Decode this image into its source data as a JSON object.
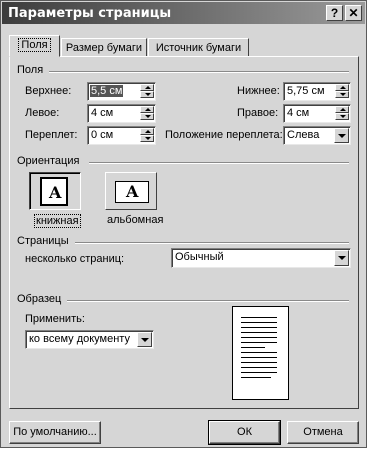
{
  "window": {
    "title": "Параметры страницы",
    "help_glyph": "?",
    "close_glyph": "✕"
  },
  "tabs": [
    {
      "label": "Поля",
      "active": true
    },
    {
      "label": "Размер бумаги",
      "active": false
    },
    {
      "label": "Источник бумаги",
      "active": false
    }
  ],
  "margins": {
    "section_title": "Поля",
    "top": {
      "label": "Верхнее:",
      "value": "5,5 см"
    },
    "bottom": {
      "label": "Нижнее:",
      "value": "5,75 см"
    },
    "left": {
      "label": "Левое:",
      "value": "4 см"
    },
    "right": {
      "label": "Правое:",
      "value": "4 см"
    },
    "gutter": {
      "label": "Переплет:",
      "value": "0 см"
    },
    "gutter_position": {
      "label": "Положение переплета:",
      "value": "Слева"
    }
  },
  "orientation": {
    "section_title": "Ориентация",
    "portrait_label": "книжная",
    "landscape_label": "альбомная",
    "icon_letter": "A",
    "selected": "portrait"
  },
  "pages": {
    "section_title": "Страницы",
    "multiple_label": "несколько страниц:",
    "multiple_value": "Обычный"
  },
  "sample": {
    "section_title": "Образец",
    "apply_label": "Применить:",
    "apply_value": "ко всему документу"
  },
  "buttons": {
    "default": "По умолчанию...",
    "ok": "ОК",
    "cancel": "Отмена"
  }
}
